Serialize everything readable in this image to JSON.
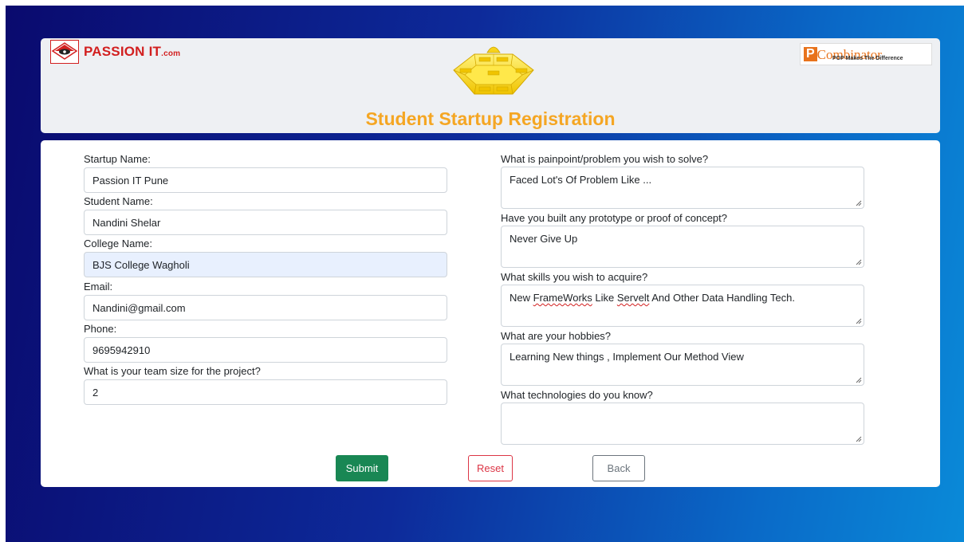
{
  "header": {
    "logo_left": {
      "brand": "PASSION IT",
      "suffix": ".com"
    },
    "logo_right": {
      "initial": "P",
      "word": "Combinator",
      "tagline": "POP Makes The Difference"
    },
    "title": "Student Startup Registration",
    "accent_color": "#f5a623"
  },
  "form": {
    "startup_name": {
      "label": "Startup Name:",
      "value": "Passion IT Pune"
    },
    "student_name": {
      "label": "Student Name:",
      "value": "Nandini Shelar"
    },
    "college_name": {
      "label": "College Name:",
      "value": "BJS College Wagholi"
    },
    "email": {
      "label": "Email:",
      "value": "Nandini@gmail.com"
    },
    "phone": {
      "label": "Phone:",
      "value": "9695942910"
    },
    "team_size": {
      "label": "What is your team size for the project?",
      "value": "2"
    },
    "painpoint": {
      "label": "What is painpoint/problem you wish to solve?",
      "value": "Faced Lot's Of Problem Like ..."
    },
    "prototype": {
      "label": "Have you built any prototype or proof of concept?",
      "value": "Never Give Up"
    },
    "skills": {
      "label": "What skills you wish to acquire?",
      "value_parts": [
        "New ",
        "FrameWorks",
        " Like ",
        "Servelt",
        " And Other Data Handling Tech."
      ]
    },
    "hobbies": {
      "label": "What are your hobbies?",
      "value": "Learning New things , Implement Our Method View"
    },
    "technologies": {
      "label": "What technologies do you know?",
      "value": ""
    }
  },
  "buttons": {
    "submit": "Submit",
    "reset": "Reset",
    "back": "Back"
  },
  "colors": {
    "submit": "#198754",
    "reset": "#dc3545",
    "back": "#6c757d"
  }
}
